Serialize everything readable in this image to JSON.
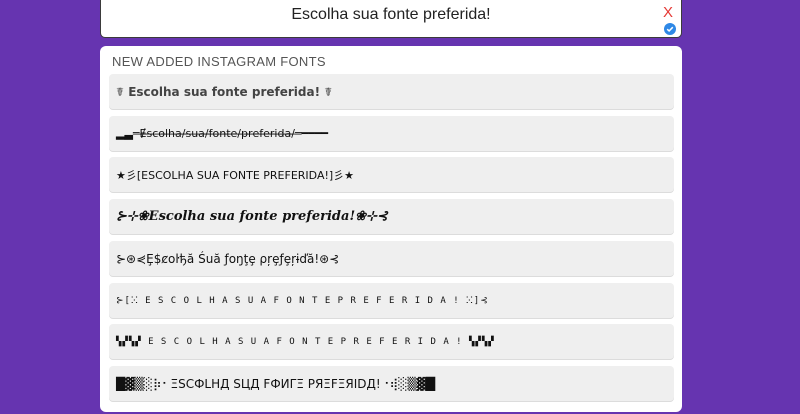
{
  "input": {
    "value": "Escolha sua fonte preferida!",
    "clear_label": "X"
  },
  "section": {
    "title": "NEW ADDED INSTAGRAM FONTS"
  },
  "fonts": [
    {
      "text": "☤ Escolha sua fonte preferida! ☤"
    },
    {
      "text": "▂▃═Ɇ̶s̶c̶o̶l̶h̶a̶/̶s̶u̶a̶/̶f̶o̶n̶t̶e̶/̶p̶r̶e̶f̶e̶r̶i̶d̶a̶/̶═━━━━"
    },
    {
      "text": "★彡[ESCOLHA SUA FONTE PREFERIDA!]彡★"
    },
    {
      "text": "⊱⊹❀𝑬𝒔𝒄𝒐𝒍𝒉𝒂 𝒔𝒖𝒂 𝒇𝒐𝒏𝒕𝒆 𝒑𝒓𝒆𝒇𝒆𝒓𝒊𝒅𝒂!❀⊹⊰"
    },
    {
      "text": "⊱⊛⋞Ȩ$ȼoŀђă Śuă ƒoŋţȩ ρŗȩƒȩŗɨďă!⊛⊰"
    },
    {
      "text": "⊱[ⵘ E S C O L H A  S U A  F O N T E  P R E F E R I D A ! ⵘ]⊰"
    },
    {
      "text": "▚▞▚▞ E S C O L H A  S U A  F O N T E  P R E F E R I D A ! ▚▞▚▞"
    },
    {
      "text": "█▓▒░⡷⠂ΞSCФLHД SЦД FФИΓΞ PЯΞFΞЯIDД!⠐⢾░▒▓█"
    }
  ],
  "colors": {
    "background": "#6634b0",
    "clear": "#e53935",
    "check": "#2e88e6"
  },
  "icons": {
    "clear": "close-icon",
    "check": "check-circle-icon"
  }
}
